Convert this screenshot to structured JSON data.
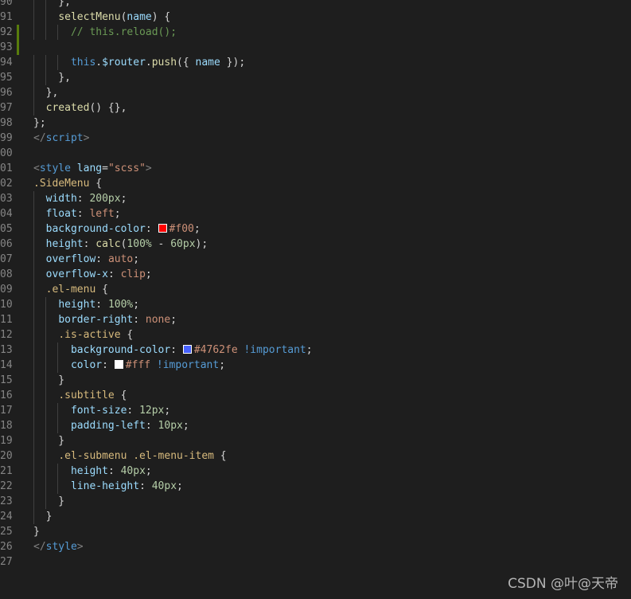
{
  "editor": {
    "language": "vue",
    "theme": "dark",
    "lines": [
      {
        "num": "90",
        "tokens": [
          [
            "p",
            "    },"
          ]
        ]
      },
      {
        "num": "91",
        "tokens": [
          [
            "p",
            "    "
          ],
          [
            "f",
            "selectMenu"
          ],
          [
            "p",
            "("
          ],
          [
            "v",
            "name"
          ],
          [
            "p",
            ") {"
          ]
        ]
      },
      {
        "num": "92",
        "tokens": [
          [
            "p",
            "      "
          ],
          [
            "c",
            "// this.reload();"
          ]
        ],
        "modified": true
      },
      {
        "num": "93",
        "tokens": [],
        "modified": true
      },
      {
        "num": "94",
        "tokens": [
          [
            "p",
            "      "
          ],
          [
            "k",
            "this"
          ],
          [
            "p",
            "."
          ],
          [
            "v",
            "$router"
          ],
          [
            "p",
            "."
          ],
          [
            "f",
            "push"
          ],
          [
            "p",
            "({ "
          ],
          [
            "v",
            "name"
          ],
          [
            "p",
            " });"
          ]
        ]
      },
      {
        "num": "95",
        "tokens": [
          [
            "p",
            "    },"
          ]
        ]
      },
      {
        "num": "96",
        "tokens": [
          [
            "p",
            "  },"
          ]
        ]
      },
      {
        "num": "97",
        "tokens": [
          [
            "p",
            "  "
          ],
          [
            "f",
            "created"
          ],
          [
            "p",
            "() {},"
          ]
        ]
      },
      {
        "num": "98",
        "tokens": [
          [
            "p",
            "};"
          ]
        ]
      },
      {
        "num": "99",
        "tokens": [
          [
            "u",
            "</"
          ],
          [
            "t",
            "script"
          ],
          [
            "u",
            ">"
          ]
        ]
      },
      {
        "num": "00",
        "tokens": []
      },
      {
        "num": "01",
        "tokens": [
          [
            "u",
            "<"
          ],
          [
            "t",
            "style"
          ],
          [
            "p",
            " "
          ],
          [
            "v",
            "lang"
          ],
          [
            "p",
            "="
          ],
          [
            "s",
            "\"scss\""
          ],
          [
            "u",
            ">"
          ]
        ]
      },
      {
        "num": "02",
        "tokens": [
          [
            "e",
            ".SideMenu"
          ],
          [
            "p",
            " {"
          ]
        ]
      },
      {
        "num": "03",
        "tokens": [
          [
            "p",
            "  "
          ],
          [
            "v",
            "width"
          ],
          [
            "p",
            ": "
          ],
          [
            "n",
            "200px"
          ],
          [
            "p",
            ";"
          ]
        ]
      },
      {
        "num": "04",
        "tokens": [
          [
            "p",
            "  "
          ],
          [
            "v",
            "float"
          ],
          [
            "p",
            ": "
          ],
          [
            "s",
            "left"
          ],
          [
            "p",
            ";"
          ]
        ]
      },
      {
        "num": "05",
        "tokens": [
          [
            "p",
            "  "
          ],
          [
            "v",
            "background-color"
          ],
          [
            "p",
            ": "
          ],
          [
            "w",
            "#ff0000"
          ],
          [
            "s",
            "#f00"
          ],
          [
            "p",
            ";"
          ]
        ]
      },
      {
        "num": "06",
        "tokens": [
          [
            "p",
            "  "
          ],
          [
            "v",
            "height"
          ],
          [
            "p",
            ": "
          ],
          [
            "f",
            "calc"
          ],
          [
            "p",
            "("
          ],
          [
            "n",
            "100%"
          ],
          [
            "p",
            " - "
          ],
          [
            "n",
            "60px"
          ],
          [
            "p",
            ");"
          ]
        ]
      },
      {
        "num": "07",
        "tokens": [
          [
            "p",
            "  "
          ],
          [
            "v",
            "overflow"
          ],
          [
            "p",
            ": "
          ],
          [
            "s",
            "auto"
          ],
          [
            "p",
            ";"
          ]
        ]
      },
      {
        "num": "08",
        "tokens": [
          [
            "p",
            "  "
          ],
          [
            "v",
            "overflow-x"
          ],
          [
            "p",
            ": "
          ],
          [
            "s",
            "clip"
          ],
          [
            "p",
            ";"
          ]
        ]
      },
      {
        "num": "09",
        "tokens": [
          [
            "p",
            "  "
          ],
          [
            "e",
            ".el-menu"
          ],
          [
            "p",
            " {"
          ]
        ]
      },
      {
        "num": "10",
        "tokens": [
          [
            "p",
            "    "
          ],
          [
            "v",
            "height"
          ],
          [
            "p",
            ": "
          ],
          [
            "n",
            "100%"
          ],
          [
            "p",
            ";"
          ]
        ]
      },
      {
        "num": "11",
        "tokens": [
          [
            "p",
            "    "
          ],
          [
            "v",
            "border-right"
          ],
          [
            "p",
            ": "
          ],
          [
            "s",
            "none"
          ],
          [
            "p",
            ";"
          ]
        ]
      },
      {
        "num": "12",
        "tokens": [
          [
            "p",
            "    "
          ],
          [
            "e",
            ".is-active"
          ],
          [
            "p",
            " {"
          ]
        ]
      },
      {
        "num": "13",
        "tokens": [
          [
            "p",
            "      "
          ],
          [
            "v",
            "background-color"
          ],
          [
            "p",
            ": "
          ],
          [
            "w",
            "#4762fe"
          ],
          [
            "s",
            "#4762fe"
          ],
          [
            "p",
            " "
          ],
          [
            "k",
            "!important"
          ],
          [
            "p",
            ";"
          ]
        ]
      },
      {
        "num": "14",
        "tokens": [
          [
            "p",
            "      "
          ],
          [
            "v",
            "color"
          ],
          [
            "p",
            ": "
          ],
          [
            "w",
            "#ffffff"
          ],
          [
            "s",
            "#fff"
          ],
          [
            "p",
            " "
          ],
          [
            "k",
            "!important"
          ],
          [
            "p",
            ";"
          ]
        ]
      },
      {
        "num": "15",
        "tokens": [
          [
            "p",
            "    }"
          ]
        ]
      },
      {
        "num": "16",
        "tokens": [
          [
            "p",
            "    "
          ],
          [
            "e",
            ".subtitle"
          ],
          [
            "p",
            " {"
          ]
        ]
      },
      {
        "num": "17",
        "tokens": [
          [
            "p",
            "      "
          ],
          [
            "v",
            "font-size"
          ],
          [
            "p",
            ": "
          ],
          [
            "n",
            "12px"
          ],
          [
            "p",
            ";"
          ]
        ]
      },
      {
        "num": "18",
        "tokens": [
          [
            "p",
            "      "
          ],
          [
            "v",
            "padding-left"
          ],
          [
            "p",
            ": "
          ],
          [
            "n",
            "10px"
          ],
          [
            "p",
            ";"
          ]
        ]
      },
      {
        "num": "19",
        "tokens": [
          [
            "p",
            "    }"
          ]
        ]
      },
      {
        "num": "20",
        "tokens": [
          [
            "p",
            "    "
          ],
          [
            "e",
            ".el-submenu .el-menu-item"
          ],
          [
            "p",
            " {"
          ]
        ]
      },
      {
        "num": "21",
        "tokens": [
          [
            "p",
            "      "
          ],
          [
            "v",
            "height"
          ],
          [
            "p",
            ": "
          ],
          [
            "n",
            "40px"
          ],
          [
            "p",
            ";"
          ]
        ]
      },
      {
        "num": "22",
        "tokens": [
          [
            "p",
            "      "
          ],
          [
            "v",
            "line-height"
          ],
          [
            "p",
            ": "
          ],
          [
            "n",
            "40px"
          ],
          [
            "p",
            ";"
          ]
        ]
      },
      {
        "num": "23",
        "tokens": [
          [
            "p",
            "    }"
          ]
        ]
      },
      {
        "num": "24",
        "tokens": [
          [
            "p",
            "  }"
          ]
        ]
      },
      {
        "num": "25",
        "tokens": [
          [
            "p",
            "}"
          ]
        ]
      },
      {
        "num": "26",
        "tokens": [
          [
            "u",
            "</"
          ],
          [
            "t",
            "style"
          ],
          [
            "u",
            ">"
          ]
        ]
      },
      {
        "num": "27",
        "tokens": []
      }
    ]
  },
  "watermark": "CSDN @叶@天帝",
  "colors": {
    "background": "#1e1e1e",
    "line_number": "#858585",
    "modified_gutter": "#587c0c"
  }
}
